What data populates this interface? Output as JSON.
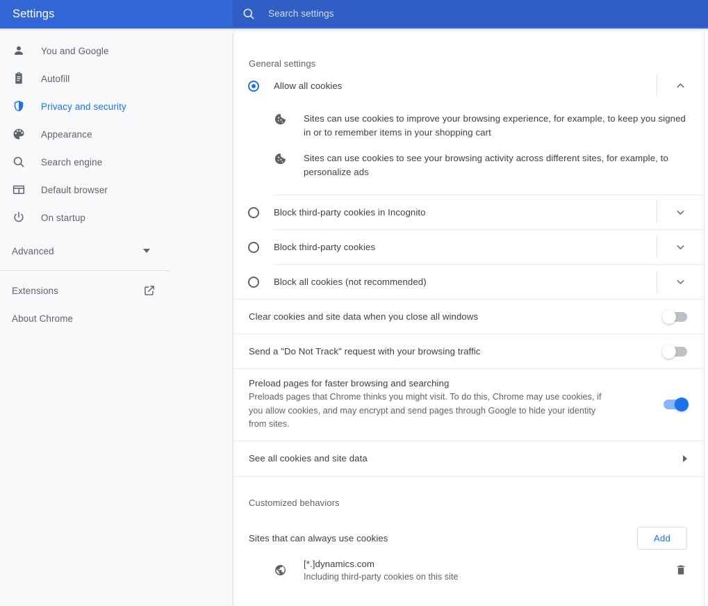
{
  "header": {
    "title": "Settings",
    "search_placeholder": "Search settings",
    "search_value": "",
    "search_icon": "search-icon",
    "bg_color": "#3367d6",
    "search_bg_color": "#2f5fc4"
  },
  "sidebar": {
    "items": [
      {
        "label": "You and Google",
        "icon": "person-icon",
        "active": false
      },
      {
        "label": "Autofill",
        "icon": "clipboard-icon",
        "active": false
      },
      {
        "label": "Privacy and security",
        "icon": "shield-icon",
        "active": true
      },
      {
        "label": "Appearance",
        "icon": "palette-icon",
        "active": false
      },
      {
        "label": "Search engine",
        "icon": "search-icon",
        "active": false
      },
      {
        "label": "Default browser",
        "icon": "browser-window-icon",
        "active": false
      },
      {
        "label": "On startup",
        "icon": "power-icon",
        "active": false
      }
    ],
    "advanced": {
      "label": "Advanced",
      "icon": "caret-down-icon"
    },
    "extensions": {
      "label": "Extensions",
      "icon": "external-link-icon"
    },
    "about": {
      "label": "About Chrome"
    },
    "active_color": "#1a73e8",
    "bg_color": "#f8f9fa"
  },
  "main": {
    "general_settings_label": "General settings",
    "cookie_options": [
      {
        "label": "Allow all cookies",
        "selected": true,
        "expanded": true,
        "chevron": "chevron-up-icon",
        "details": [
          {
            "icon": "cookie-icon",
            "text": "Sites can use cookies to improve your browsing experience, for example, to keep you signed in or to remember items in your shopping cart"
          },
          {
            "icon": "cookie-icon",
            "text": "Sites can use cookies to see your browsing activity across different sites, for example, to personalize ads"
          }
        ]
      },
      {
        "label": "Block third-party cookies in Incognito",
        "selected": false,
        "expanded": false,
        "chevron": "chevron-down-icon",
        "details": []
      },
      {
        "label": "Block third-party cookies",
        "selected": false,
        "expanded": false,
        "chevron": "chevron-down-icon",
        "details": []
      },
      {
        "label": "Block all cookies (not recommended)",
        "selected": false,
        "expanded": false,
        "chevron": "chevron-down-icon",
        "details": []
      }
    ],
    "toggles": [
      {
        "title": "Clear cookies and site data when you close all windows",
        "sub": "",
        "on": false
      },
      {
        "title": "Send a \"Do Not Track\" request with your browsing traffic",
        "sub": "",
        "on": false
      },
      {
        "title": "Preload pages for faster browsing and searching",
        "sub": "Preloads pages that Chrome thinks you might visit. To do this, Chrome may use cookies, if you allow cookies, and may encrypt and send pages through Google to hide your identity from sites.",
        "on": true
      }
    ],
    "see_all": {
      "label": "See all cookies and site data",
      "icon": "arrow-right-icon"
    },
    "customized_behaviors_label": "Customized behaviors",
    "always_allow": {
      "label": "Sites that can always use cookies",
      "add_button": "Add",
      "sites": [
        {
          "icon": "globe-icon",
          "name": "[*.]dynamics.com",
          "sub": "Including third-party cookies on this site",
          "delete_icon": "trash-icon"
        }
      ]
    }
  }
}
